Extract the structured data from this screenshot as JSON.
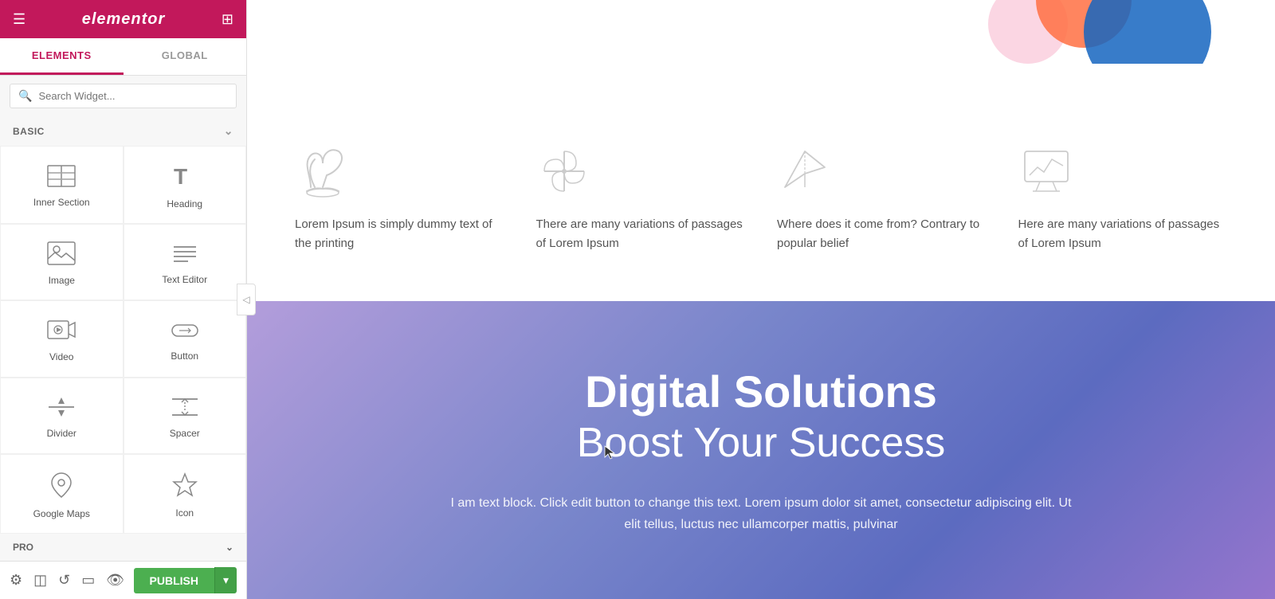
{
  "sidebar": {
    "logo": "elementor",
    "tabs": [
      {
        "label": "ELEMENTS",
        "active": true
      },
      {
        "label": "GLOBAL",
        "active": false
      }
    ],
    "search_placeholder": "Search Widget...",
    "sections": [
      {
        "label": "BASIC",
        "widgets": [
          {
            "id": "inner-section",
            "label": "Inner Section",
            "icon": "inner-section-icon"
          },
          {
            "id": "heading",
            "label": "Heading",
            "icon": "heading-icon"
          },
          {
            "id": "image",
            "label": "Image",
            "icon": "image-icon"
          },
          {
            "id": "text-editor",
            "label": "Text Editor",
            "icon": "text-editor-icon"
          },
          {
            "id": "video",
            "label": "Video",
            "icon": "video-icon"
          },
          {
            "id": "button",
            "label": "Button",
            "icon": "button-icon"
          },
          {
            "id": "divider",
            "label": "Divider",
            "icon": "divider-icon"
          },
          {
            "id": "spacer",
            "label": "Spacer",
            "icon": "spacer-icon"
          },
          {
            "id": "google-maps",
            "label": "Google Maps",
            "icon": "google-maps-icon"
          },
          {
            "id": "icon",
            "label": "Icon",
            "icon": "icon-icon"
          }
        ]
      },
      {
        "label": "PRO"
      }
    ]
  },
  "footer": {
    "publish_label": "PUBLISH"
  },
  "canvas": {
    "features": [
      {
        "icon": "plant-icon",
        "text": "Lorem Ipsum is simply dummy text of the printing"
      },
      {
        "icon": "pinwheel-icon",
        "text": "There are many variations of passages of Lorem Ipsum"
      },
      {
        "icon": "paper-plane-icon",
        "text": "Where does it come from? Contrary to popular belief"
      },
      {
        "icon": "monitor-icon",
        "text": "Here are many variations of passages of Lorem Ipsum"
      }
    ],
    "hero": {
      "title_bold": "Digital Solutions",
      "title_light": "Boost Your Success",
      "subtitle": "I am text block. Click edit button to change this text. Lorem ipsum dolor sit amet, consectetur adipiscing elit. Ut elit tellus, luctus nec ullamcorper mattis, pulvinar"
    }
  }
}
